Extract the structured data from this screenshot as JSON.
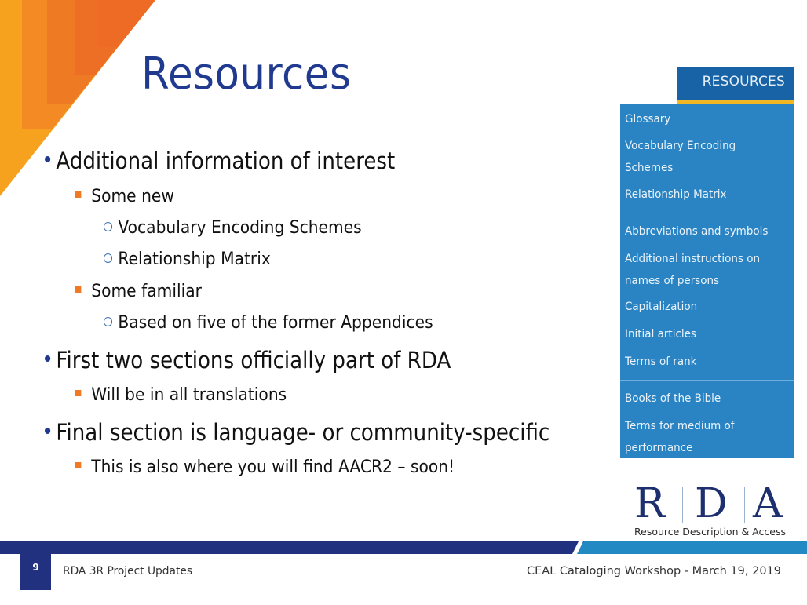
{
  "slide": {
    "title": "Resources",
    "bullets": [
      {
        "level": 1,
        "text": "Additional information of interest"
      },
      {
        "level": 2,
        "text": "Some new"
      },
      {
        "level": 3,
        "text": "Vocabulary Encoding Schemes"
      },
      {
        "level": 3,
        "text": "Relationship Matrix"
      },
      {
        "level": 2,
        "text": "Some familiar"
      },
      {
        "level": 3,
        "text": "Based on five of the former Appendices"
      },
      {
        "level": 1,
        "text": "First two sections officially part of RDA"
      },
      {
        "level": 2,
        "text": "Will be in all translations"
      },
      {
        "level": 1,
        "text": "Final section is language- or community-specific"
      },
      {
        "level": 2,
        "text": "This is also where you will find AACR2 – soon!"
      }
    ]
  },
  "resources_menu": {
    "tab_label": "RESOURCES",
    "groups": [
      {
        "items": [
          {
            "label_lines": [
              "Glossary"
            ]
          },
          {
            "label_lines": [
              "Vocabulary Encoding",
              "Schemes"
            ]
          },
          {
            "label_lines": [
              "Relationship Matrix"
            ]
          }
        ]
      },
      {
        "items": [
          {
            "label_lines": [
              "Abbreviations and symbols"
            ]
          },
          {
            "label_lines": [
              "Additional instructions on",
              "names of persons"
            ]
          },
          {
            "label_lines": [
              "Capitalization"
            ]
          },
          {
            "label_lines": [
              "Initial articles"
            ]
          },
          {
            "label_lines": [
              "Terms of rank"
            ]
          }
        ]
      },
      {
        "items": [
          {
            "label_lines": [
              "Books of the Bible"
            ]
          },
          {
            "label_lines": [
              "Terms for medium of",
              "performance"
            ]
          }
        ]
      }
    ]
  },
  "logo": {
    "letters": [
      "R",
      "D",
      "A"
    ],
    "subtitle": "Resource Description & Access"
  },
  "footer": {
    "page_number": "9",
    "left_text": "RDA 3R Project Updates",
    "right_text": "CEAL Cataloging Workshop  - March 19, 2019"
  },
  "colors": {
    "title": "#1f3a8f",
    "accent_orange": "#f07a24",
    "menu_blue": "#2a84c3",
    "menu_tab_blue": "#1763a6",
    "menu_tab_underline": "#f2b622",
    "footer_navy": "#21307f",
    "footer_cyan": "#2389c3"
  }
}
